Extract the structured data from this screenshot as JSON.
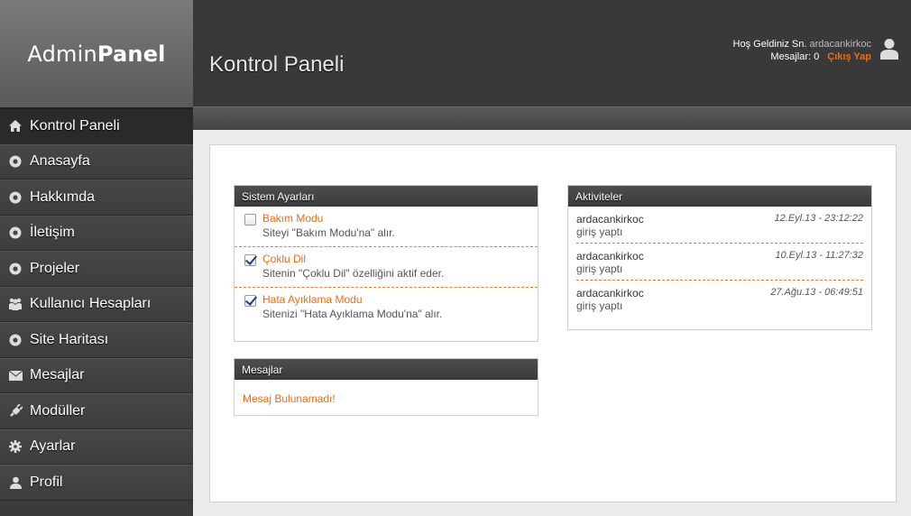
{
  "logo": {
    "light": "Admin",
    "bold": "Panel"
  },
  "sidebar": {
    "items": [
      {
        "label": "Kontrol Paneli",
        "icon": "home-icon",
        "active": true
      },
      {
        "label": "Anasayfa",
        "icon": "circle-icon"
      },
      {
        "label": "Hakkımda",
        "icon": "circle-icon"
      },
      {
        "label": "İletişim",
        "icon": "circle-icon"
      },
      {
        "label": "Projeler",
        "icon": "circle-icon"
      },
      {
        "label": "Kullanıcı Hesapları",
        "icon": "users-icon"
      },
      {
        "label": "Site Haritası",
        "icon": "circle-icon"
      },
      {
        "label": "Mesajlar",
        "icon": "envelope-icon"
      },
      {
        "label": "Modüller",
        "icon": "plug-icon"
      },
      {
        "label": "Ayarlar",
        "icon": "gear-icon"
      },
      {
        "label": "Profil",
        "icon": "user-icon"
      }
    ]
  },
  "header": {
    "title": "Kontrol Paneli",
    "welcome": "Hoş Geldiniz Sn.",
    "username": "ardacankirkoc",
    "messages_label": "Mesajlar: 0",
    "logout": "Çıkış Yap"
  },
  "settings": {
    "title": "Sistem Ayarları",
    "items": [
      {
        "title": "Bakım Modu",
        "desc": "Siteyi \"Bakım Modu'na\" alır.",
        "checked": false
      },
      {
        "title": "Çoklu Dil",
        "desc": "Sitenin \"Çoklu Dil\" özelliğini aktif eder.",
        "checked": true
      },
      {
        "title": "Hata Ayıklama Modu",
        "desc": "Sitenizi \"Hata Ayıklama Modu'na\" alır.",
        "checked": true
      }
    ]
  },
  "messages": {
    "title": "Mesajlar",
    "empty": "Mesaj Bulunamadı!"
  },
  "activity": {
    "title": "Aktiviteler",
    "items": [
      {
        "user": "ardacankirkoc",
        "action": "giriş yaptı",
        "time": "12.Eyl.13 - 23:12:22"
      },
      {
        "user": "ardacankirkoc",
        "action": "giriş yaptı",
        "time": "10.Eyl.13 - 11:27:32"
      },
      {
        "user": "ardacankirkoc",
        "action": "giriş yaptı",
        "time": "27.Ağu.13 - 06:49:51"
      }
    ]
  },
  "colors": {
    "accent": "#f26a14",
    "sidebar": "#3b3b3b",
    "header": "#393939"
  }
}
